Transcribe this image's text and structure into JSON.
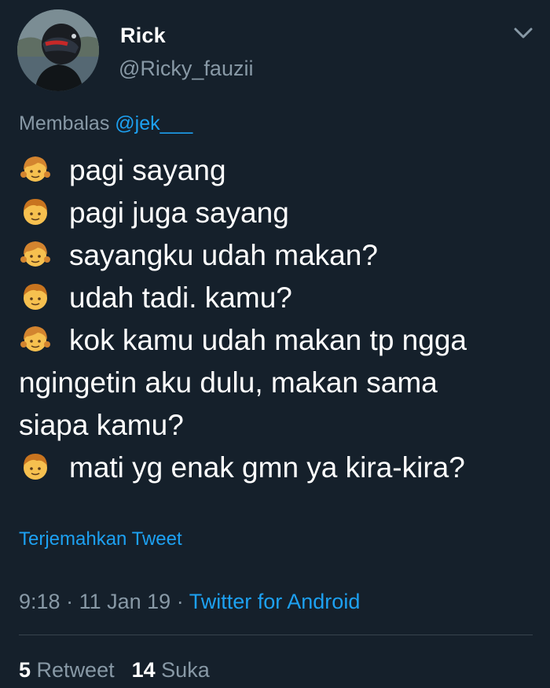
{
  "user": {
    "name": "Rick",
    "handle": "@Ricky_fauzii"
  },
  "reply": {
    "prefix": "Membalas",
    "mention": "@jek___"
  },
  "lines": [
    {
      "icon": "girl-emoji-icon",
      "text": "pagi sayang"
    },
    {
      "icon": "boy-emoji-icon",
      "text": "pagi juga sayang"
    },
    {
      "icon": "girl-emoji-icon",
      "text": "sayangku udah makan?"
    },
    {
      "icon": "boy-emoji-icon",
      "text": "udah tadi. kamu?"
    },
    {
      "icon": "girl-emoji-icon",
      "text": "kok kamu udah makan tp ngga"
    },
    {
      "icon": null,
      "text": "ngingetin aku dulu, makan sama"
    },
    {
      "icon": null,
      "text": "siapa kamu?"
    },
    {
      "icon": "boy-emoji-icon",
      "text": "mati yg enak gmn ya kira-kira?"
    }
  ],
  "translate_label": "Terjemahkan Tweet",
  "meta": {
    "time": "9:18",
    "separator": "·",
    "date": "11 Jan 19",
    "source": "Twitter for Android"
  },
  "stats": {
    "retweets_count": "5",
    "retweets_label": "Retweet",
    "likes_count": "14",
    "likes_label": "Suka"
  },
  "colors": {
    "background": "#15202b",
    "link": "#1da1f2",
    "secondary_text": "#8899a6",
    "primary_text": "#ffffff"
  }
}
